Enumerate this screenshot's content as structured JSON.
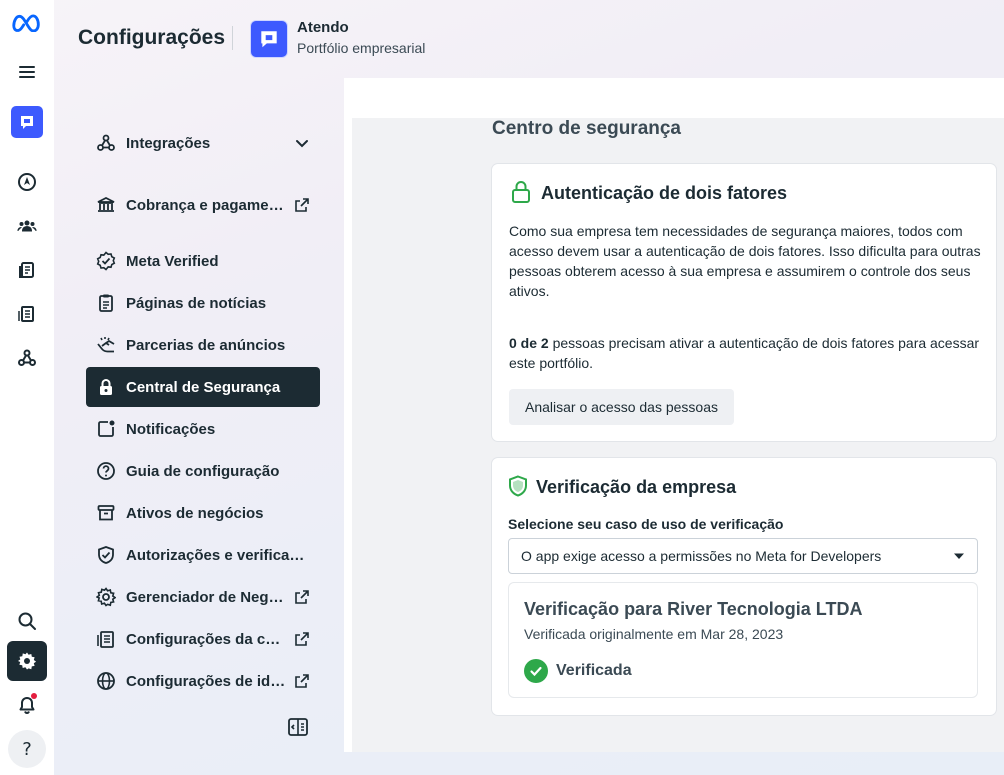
{
  "header": {
    "title": "Configurações",
    "portfolio_name": "Atendo",
    "portfolio_subtitle": "Portfólio empresarial"
  },
  "nav": {
    "items": [
      {
        "label": "Integrações",
        "icon": "integrations-icon",
        "has_chevron": true
      },
      {
        "label": "Cobrança e pagamentos",
        "icon": "bank-icon",
        "external": true
      },
      {
        "label": "Meta Verified",
        "icon": "verified-badge-icon"
      },
      {
        "label": "Páginas de notícias",
        "icon": "clipboard-icon"
      },
      {
        "label": "Parcerias de anúncios",
        "icon": "handshake-icon"
      },
      {
        "label": "Central de Segurança",
        "icon": "lock-icon",
        "active": true
      },
      {
        "label": "Notificações",
        "icon": "notification-square-icon"
      },
      {
        "label": "Guia de configuração",
        "icon": "question-circle-icon"
      },
      {
        "label": "Ativos de negócios",
        "icon": "archive-icon"
      },
      {
        "label": "Autorizações e verificações",
        "icon": "shield-check-icon"
      },
      {
        "label": "Gerenciador de Negócios",
        "icon": "gear-icon",
        "external": true
      },
      {
        "label": "Configurações da conta",
        "icon": "document-settings-icon",
        "external": true
      },
      {
        "label": "Configurações de idioma",
        "icon": "globe-icon",
        "external": true
      }
    ]
  },
  "main": {
    "section_title": "Centro de segurança",
    "two_factor": {
      "title": "Autenticação de dois fatores",
      "description": "Como sua empresa tem necessidades de segurança maiores, todos com acesso devem usar a autenticação de dois fatores. Isso dificulta para outras pessoas obterem acesso à sua empresa e assumirem o controle dos seus ativos.",
      "count_bold": "0 de 2",
      "count_text": " pessoas precisam ativar a autenticação de dois fatores para acessar este portfólio.",
      "button_label": "Analisar o acesso das pessoas"
    },
    "verification": {
      "title": "Verificação da empresa",
      "select_label": "Selecione seu caso de uso de verificação",
      "select_value": "O app exige acesso a permissões no Meta for Developers",
      "card_title": "Verificação para River Tecnologia LTDA",
      "card_subtitle": "Verificada originalmente em Mar 28, 2023",
      "status": "Verificada",
      "status_color": "#2ea84a"
    }
  },
  "colors": {
    "accent_dark": "#1c2b33",
    "brand_blue": "#0866ff",
    "notification_dot": "#e41e3f"
  }
}
